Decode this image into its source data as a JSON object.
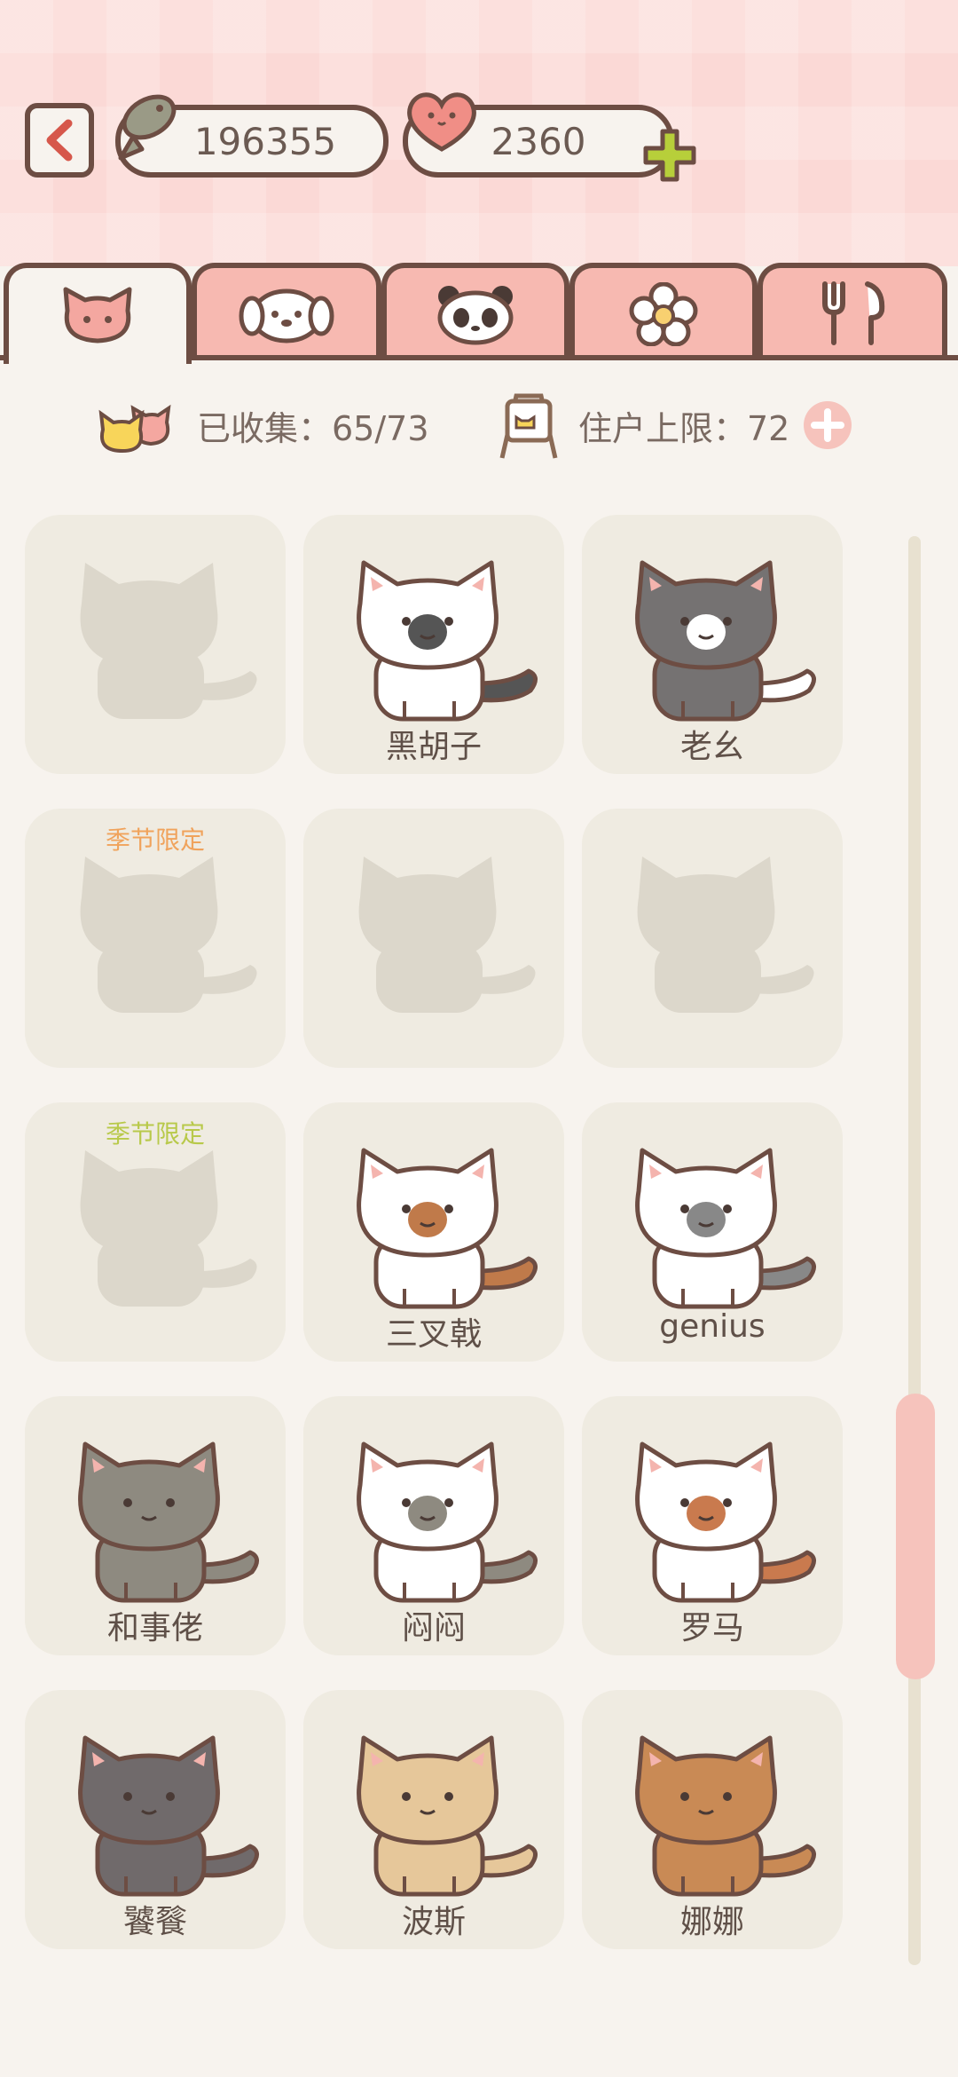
{
  "header": {
    "fish_value": "196355",
    "heart_value": "2360",
    "icons": [
      "back-arrow-icon",
      "fish-icon",
      "heart-icon",
      "plus-icon"
    ]
  },
  "tabs": [
    {
      "name": "cat",
      "icon": "cat-face-icon",
      "active": true
    },
    {
      "name": "dog",
      "icon": "dog-face-icon",
      "active": false
    },
    {
      "name": "panda",
      "icon": "panda-face-icon",
      "active": false
    },
    {
      "name": "flower",
      "icon": "flower-icon",
      "active": false
    },
    {
      "name": "food",
      "icon": "fork-spoon-icon",
      "active": false
    }
  ],
  "stats": {
    "collected_label": "已收集：65/73",
    "residents_label": "住户上限：72"
  },
  "colors": {
    "accent": "#f7b9b1",
    "outline": "#6d4d43",
    "card": "#efebe1",
    "seasonal_orange": "#f0a35c",
    "seasonal_green": "#b8c94a"
  },
  "cats": [
    {
      "name": "",
      "locked": true,
      "tag": ""
    },
    {
      "name": "黑胡子",
      "locked": false,
      "tag": "",
      "body": "#ffffff",
      "patch": "#555"
    },
    {
      "name": "老幺",
      "locked": false,
      "tag": "",
      "body": "#757272",
      "patch": "#fff"
    },
    {
      "name": "",
      "locked": true,
      "tag": "季节限定",
      "tag_color": "orange"
    },
    {
      "name": "",
      "locked": true,
      "tag": ""
    },
    {
      "name": "",
      "locked": true,
      "tag": ""
    },
    {
      "name": "",
      "locked": true,
      "tag": "季节限定",
      "tag_color": "green"
    },
    {
      "name": "三叉戟",
      "locked": false,
      "tag": "",
      "body": "#ffffff",
      "patch": "#c07a4a"
    },
    {
      "name": "genius",
      "locked": false,
      "tag": "",
      "body": "#ffffff",
      "patch": "#888"
    },
    {
      "name": "和事佬",
      "locked": false,
      "tag": "",
      "body": "#8e8a80",
      "patch": "#8e8a80"
    },
    {
      "name": "闷闷",
      "locked": false,
      "tag": "",
      "body": "#ffffff",
      "patch": "#8e8a80"
    },
    {
      "name": "罗马",
      "locked": false,
      "tag": "",
      "body": "#ffffff",
      "patch": "#c97a4e"
    },
    {
      "name": "饕餮",
      "locked": false,
      "tag": "",
      "body": "#706a6b",
      "patch": "#706a6b"
    },
    {
      "name": "波斯",
      "locked": false,
      "tag": "",
      "body": "#e6c79a",
      "patch": "#e6c79a"
    },
    {
      "name": "娜娜",
      "locked": false,
      "tag": "",
      "body": "#c98a55",
      "patch": "#c98a55"
    }
  ]
}
